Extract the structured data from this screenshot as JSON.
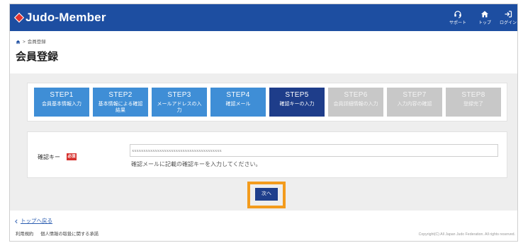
{
  "colors": {
    "header": "#1d4ea1",
    "step_done": "#3f8ed6",
    "step_current": "#1e3d8a",
    "step_pending": "#c8c8c8",
    "required_badge": "#d6302c",
    "button": "#1f3f8c",
    "highlight": "#f39b1d",
    "link": "#2a5cb0",
    "content_bg": "#eeeeee"
  },
  "header": {
    "logo_icon": "diamond-logo-icon",
    "brand": "Judo-Member",
    "nav": [
      {
        "icon": "headset-icon",
        "label": "サポート"
      },
      {
        "icon": "home-icon",
        "label": "トップ"
      },
      {
        "icon": "login-icon",
        "label": "ログイン"
      }
    ]
  },
  "breadcrumb": {
    "home_icon": "home-icon",
    "separator": ">",
    "current": "会員登録"
  },
  "page_title": "会員登録",
  "current_step": 5,
  "steps": [
    {
      "label": "STEP1",
      "desc": "会員基本情報入力"
    },
    {
      "label": "STEP2",
      "desc": "基本情報による確認結果"
    },
    {
      "label": "STEP3",
      "desc": "メールアドレスの入力"
    },
    {
      "label": "STEP4",
      "desc": "確認メール"
    },
    {
      "label": "STEP5",
      "desc": "確認キーの入力"
    },
    {
      "label": "STEP6",
      "desc": "会員詳細情報の入力"
    },
    {
      "label": "STEP7",
      "desc": "入力内容の確認"
    },
    {
      "label": "STEP8",
      "desc": "登録完了"
    }
  ],
  "form": {
    "field_label": "確認キー",
    "required_badge": "必須",
    "placeholder": "xxxxxxxxxxxxxxxxxxxxxxxxxxxxxxxxxxxxxxx",
    "hint": "確認メールに記載の確認キーを入力してください。"
  },
  "next_button": "次へ",
  "footer": {
    "back_icon": "chevron-left-icon",
    "back_link": "トップへ戻る",
    "links": [
      "利用規約",
      "個人情報の取扱に関する承諾"
    ],
    "copyright": "Copyright(C) All Japan Judo Federation. All rights reserved."
  }
}
